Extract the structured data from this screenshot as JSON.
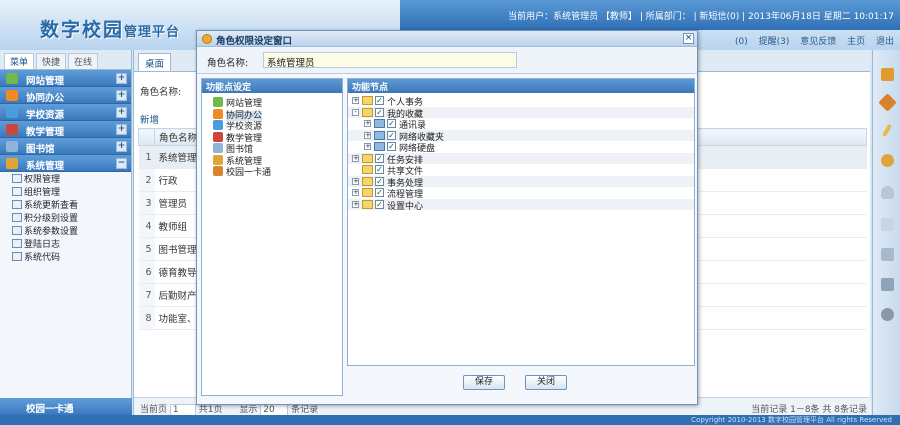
{
  "header": {
    "logo_main": "数字校园",
    "logo_sub": "管理平台",
    "status_line": "当前用户：系统管理员 【教师】 | 所属部门： | 新短信(0) | 2013年06月18日 星期二 10:01:17",
    "links": [
      "(0)",
      "提醒(3)",
      "意见反馈",
      "主页",
      "退出"
    ]
  },
  "sidebar": {
    "tabs": [
      "菜单",
      "快捷",
      "在线"
    ],
    "groups": [
      {
        "label": "网站管理",
        "color": "#6fba4a"
      },
      {
        "label": "协同办公",
        "color": "#f08a24"
      },
      {
        "label": "学校资源",
        "color": "#4a9be0"
      },
      {
        "label": "教学管理",
        "color": "#c9473b"
      },
      {
        "label": "图书馆",
        "color": "#8fb3d9"
      },
      {
        "label": "系统管理",
        "color": "#e0a53a"
      }
    ],
    "sub_items": [
      "权限管理",
      "组织管理",
      "系统更新查看",
      "积分级别设置",
      "系统参数设置",
      "登陆日志",
      "系统代码"
    ],
    "bottom": "校园一卡通"
  },
  "main": {
    "tab": "桌面",
    "role_label": "角色名称:",
    "toolbar_new": "新增",
    "column": "角色名称",
    "rows": [
      "系统管理员",
      "行政",
      "管理员",
      "教师组",
      "图书管理员",
      "德育教导员",
      "后勤财产管",
      "功能室、文"
    ],
    "pager_page": "当前页",
    "pager_page_value": "1",
    "pager_total": "共1页",
    "pager_show": "显示",
    "pager_show_value": "20",
    "pager_records": "条记录",
    "pager_summary": "当前记录 1－8条 共 8条记录"
  },
  "footer": "Copyright 2010-2013 数字校园管理平台 All rights Reserved",
  "dialog": {
    "title": "角色权限设定窗口",
    "name_label": "角色名称:",
    "name_value": "系统管理员",
    "left_head": "功能点设定",
    "right_head": "功能节点",
    "modules": [
      {
        "label": "网站管理",
        "color": "#6fba4a"
      },
      {
        "label": "协同办公",
        "color": "#f08a24"
      },
      {
        "label": "学校资源",
        "color": "#4a9be0"
      },
      {
        "label": "教学管理",
        "color": "#c9473b"
      },
      {
        "label": "图书馆",
        "color": "#8fb3d9"
      },
      {
        "label": "系统管理",
        "color": "#e0a53a"
      },
      {
        "label": "校园一卡通",
        "color": "#d8862c"
      }
    ],
    "tree": [
      {
        "label": "个人事务",
        "level": 0,
        "exp": "+"
      },
      {
        "label": "我的收藏",
        "level": 0,
        "exp": "-"
      },
      {
        "label": "通讯录",
        "level": 1,
        "exp": "+"
      },
      {
        "label": "网络收藏夹",
        "level": 1,
        "exp": "+"
      },
      {
        "label": "网络硬盘",
        "level": 1,
        "exp": "+"
      },
      {
        "label": "任务安排",
        "level": 0,
        "exp": "+"
      },
      {
        "label": "共享文件",
        "level": 0,
        "exp": ""
      },
      {
        "label": "事务处理",
        "level": 0,
        "exp": "+"
      },
      {
        "label": "流程管理",
        "level": 0,
        "exp": "+"
      },
      {
        "label": "设置中心",
        "level": 0,
        "exp": "+"
      }
    ],
    "save": "保存",
    "close": "关闭"
  }
}
